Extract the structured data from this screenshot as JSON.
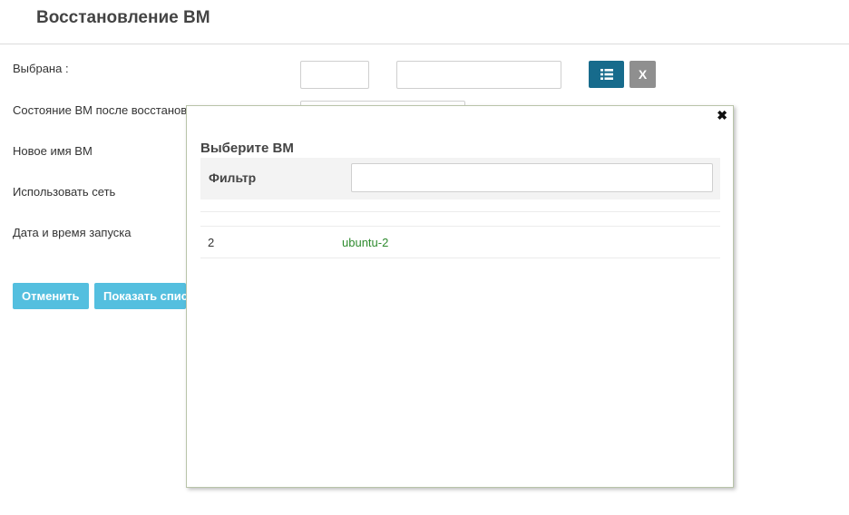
{
  "page": {
    "title": "Восстановление ВМ"
  },
  "form": {
    "selected_label": "Выбрана :",
    "state_label": "Состояние ВМ после восстановления",
    "new_name_label": "Новое имя ВМ",
    "network_label": "Использовать сеть",
    "datetime_label": "Дата и время запуска",
    "selected_id_value": "",
    "selected_name_value": "",
    "list_icon": "list-icon",
    "clear_label": "X"
  },
  "actions": {
    "cancel_label": "Отменить",
    "show_list_label": "Показать список"
  },
  "modal": {
    "close_icon": "✖",
    "title": "Выберите ВМ",
    "filter_label": "Фильтр",
    "filter_value": "",
    "rows": [
      {
        "id": "2",
        "name": "ubuntu-2"
      }
    ]
  },
  "colors": {
    "primary_button": "#176b8c",
    "secondary_button": "#8f8f8f",
    "action_button": "#54bfdf",
    "link_green": "#2e8b2e"
  }
}
